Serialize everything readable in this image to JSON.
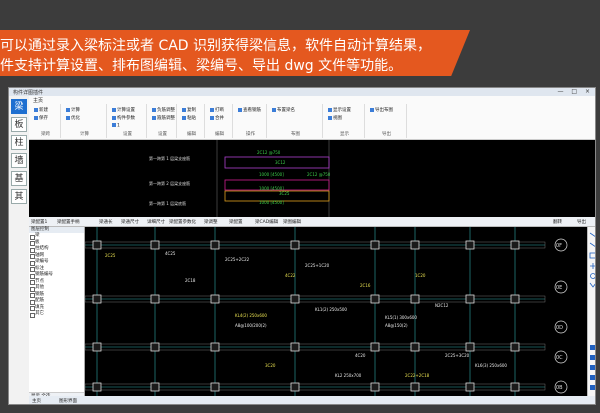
{
  "banner": {
    "line1": "可以通过录入梁标注或者 CAD 识别获得梁信息，软件自动计算结果，",
    "line2": "件支持计算设置、排布图编辑、梁编号、导出 dwg 文件等功能。"
  },
  "window": {
    "title": "构件详图插件",
    "controls": "— □ ×"
  },
  "vtabs": [
    "梁",
    "板",
    "柱",
    "墙",
    "基",
    "其"
  ],
  "ribbon": {
    "tab": "主页",
    "groups": [
      {
        "label": "梁跨",
        "items": [
          "新建",
          "保存"
        ]
      },
      {
        "label": "计算",
        "items": [
          "计算",
          "优化"
        ]
      },
      {
        "label": "设置",
        "items": [
          "计算设置",
          "构件参数",
          "1"
        ]
      },
      {
        "label": "设置",
        "items": [
          "负筋调整",
          "箍筋调整"
        ]
      },
      {
        "label": "编辑",
        "items": [
          "复制",
          "粘贴"
        ]
      },
      {
        "label": "编辑",
        "items": [
          "打断",
          "合并"
        ]
      },
      {
        "label": "操作",
        "items": [
          "查看钢筋"
        ]
      },
      {
        "label": "布图",
        "items": [
          "布置梁名"
        ]
      },
      {
        "label": "显示",
        "items": [
          "显示设置",
          "视图"
        ]
      },
      {
        "label": "导出",
        "items": [
          "导出布图"
        ]
      }
    ]
  },
  "topcad": {
    "rows": [
      "第一跨第 1 层梁支座筋",
      "第一跨第 2 层梁支座筋",
      "第一跨第 1 层梁底筋"
    ],
    "dims": [
      "2C12 @750",
      "3C12",
      "1000 [4500]",
      "2C12 @750",
      "1000 [4500]",
      "3C25",
      "1000 [4500]"
    ]
  },
  "midbar": {
    "items": [
      "梁配置1",
      "梁配置手柄",
      "梁通长",
      "梁通尺寸",
      "详细尺寸",
      "梁配置参数化",
      "梁调整",
      "梁配置",
      "梁CAD编辑",
      "梁图编辑",
      "翻转",
      "导出"
    ]
  },
  "leftpanel": {
    "header": "图层控制",
    "items": [
      "梁",
      "板",
      "柱结构",
      "轴网",
      "梁编号",
      "标注",
      "钢筋编号",
      "节点",
      "其他",
      "钢筋",
      "配筋",
      "填充",
      "其它"
    ],
    "bottom": "显示 全选"
  },
  "status": {
    "left": "主页",
    "mid": "图形界面"
  },
  "botcad": {
    "labels": [
      "2C25",
      "4C25",
      "2C25+2C22",
      "KL4(2) 250x600",
      "A8@100/200(2)",
      "2C18",
      "4C22",
      "2C25+1C20",
      "KL1(2) 250x500",
      "2C16",
      "KL5(1) 300x600",
      "A8@150(2)",
      "1C20",
      "N2C12",
      "2C25+3C20",
      "3C20",
      "KL2 250x700",
      "4C20",
      "2C22+2C18",
      "KL6(3) 250x600"
    ],
    "axis": [
      "0F",
      "0E",
      "0D",
      "0C",
      "0B"
    ]
  }
}
